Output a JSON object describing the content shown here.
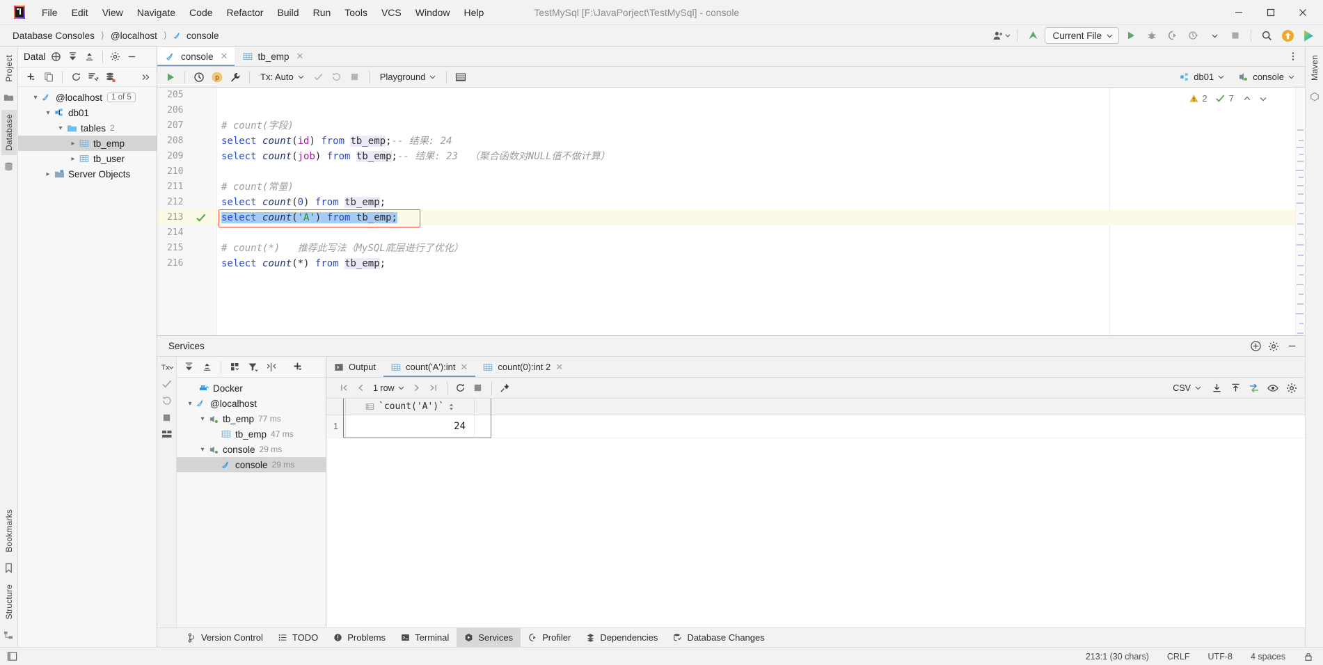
{
  "window": {
    "title": "TestMySql [F:\\JavaPorject\\TestMySql] - console",
    "minimize_label": "—",
    "maximize_label": "☐",
    "close_label": "✕"
  },
  "menubar": {
    "items": [
      {
        "label": "File"
      },
      {
        "label": "Edit"
      },
      {
        "label": "View"
      },
      {
        "label": "Navigate"
      },
      {
        "label": "Code"
      },
      {
        "label": "Refactor"
      },
      {
        "label": "Build"
      },
      {
        "label": "Run"
      },
      {
        "label": "Tools"
      },
      {
        "label": "VCS"
      },
      {
        "label": "Window"
      },
      {
        "label": "Help"
      }
    ]
  },
  "navbar": {
    "breadcrumbs": [
      "Database Consoles",
      "@localhost",
      "console"
    ],
    "run_config": "Current File",
    "icons": [
      "user-group-icon",
      "vcs-update-icon",
      "run-icon",
      "debug-icon",
      "coverage-icon",
      "profile-icon",
      "stop-icon",
      "search-icon",
      "update-available-icon",
      "ide-features-icon"
    ]
  },
  "left_stripe": {
    "tabs": [
      {
        "label": "Project",
        "active": false
      },
      {
        "label": "Database",
        "active": true
      }
    ],
    "bottom_tabs": [
      {
        "label": "Bookmarks"
      },
      {
        "label": "Structure"
      }
    ]
  },
  "right_stripe": {
    "tabs": [
      {
        "label": "Maven"
      }
    ]
  },
  "database_panel": {
    "title": "Datal",
    "header_icons": [
      "add-data-source-icon",
      "collapse-all-icon",
      "expand-all-icon",
      "settings-icon",
      "hide-icon"
    ],
    "toolbar_icons": [
      "new-icon",
      "copy-icon",
      "refresh-icon",
      "jump-to-query-icon",
      "db-tools-icon",
      "more-icon"
    ],
    "tree": [
      {
        "label": "@localhost",
        "icon": "mysql-icon",
        "depth": 0,
        "expanded": true,
        "badge": "1 of 5",
        "selected": false
      },
      {
        "label": "db01",
        "icon": "schema-icon",
        "depth": 1,
        "expanded": true,
        "selected": false
      },
      {
        "label": "tables",
        "icon": "folder-icon",
        "depth": 2,
        "expanded": true,
        "sub": "2",
        "selected": false
      },
      {
        "label": "tb_emp",
        "icon": "table-icon",
        "depth": 3,
        "expanded": false,
        "selected": true
      },
      {
        "label": "tb_user",
        "icon": "table-icon",
        "depth": 3,
        "expanded": false,
        "selected": false
      },
      {
        "label": "Server Objects",
        "icon": "server-objects-icon",
        "depth": 1,
        "expanded": false,
        "selected": false
      }
    ]
  },
  "editor": {
    "tabs": [
      {
        "label": "console",
        "icon": "mysql-icon",
        "active": true
      },
      {
        "label": "tb_emp",
        "icon": "table-icon",
        "active": false
      }
    ],
    "console_toolbar": {
      "execute_label": "run-icon",
      "history_label": "history-icon",
      "explain_label": "explain-plan-icon",
      "settings_label": "wrench-icon",
      "tx_label": "Tx: Auto",
      "commit_icon": "commit-icon",
      "rollback_icon": "rollback-icon",
      "stop_icon": "stop-icon",
      "playground_label": "Playground",
      "table_icon": "grid-icon",
      "schema_label": "db01",
      "session_label": "console"
    },
    "inspections": {
      "warnings": "2",
      "checks": "7"
    },
    "first_line_number": 205,
    "lines": [
      {
        "n": 205,
        "tokens": []
      },
      {
        "n": 206,
        "tokens": []
      },
      {
        "n": 207,
        "tokens": [
          {
            "t": "# count(字段)",
            "c": "cm"
          }
        ]
      },
      {
        "n": 208,
        "tokens": [
          {
            "t": "select ",
            "c": "kw"
          },
          {
            "t": "count",
            "c": "fn"
          },
          {
            "t": "(",
            "c": "pl"
          },
          {
            "t": "id",
            "c": "id"
          },
          {
            "t": ") ",
            "c": "pl"
          },
          {
            "t": "from ",
            "c": "kw"
          },
          {
            "t": "tb_emp",
            "c": "tbl"
          },
          {
            "t": ";",
            "c": "pl"
          },
          {
            "t": "-- ",
            "c": "cm"
          },
          {
            "t": "结果: 24",
            "c": "cm"
          }
        ]
      },
      {
        "n": 209,
        "tokens": [
          {
            "t": "select ",
            "c": "kw"
          },
          {
            "t": "count",
            "c": "fn"
          },
          {
            "t": "(",
            "c": "pl"
          },
          {
            "t": "job",
            "c": "id"
          },
          {
            "t": ") ",
            "c": "pl"
          },
          {
            "t": "from ",
            "c": "kw"
          },
          {
            "t": "tb_emp",
            "c": "tbl"
          },
          {
            "t": ";",
            "c": "pl"
          },
          {
            "t": "-- ",
            "c": "cm"
          },
          {
            "t": "结果: 23  （聚合函数对NULL值不做计算）",
            "c": "cm"
          }
        ]
      },
      {
        "n": 210,
        "tokens": []
      },
      {
        "n": 211,
        "tokens": [
          {
            "t": "# count(常量)",
            "c": "cm"
          }
        ]
      },
      {
        "n": 212,
        "tokens": [
          {
            "t": "select ",
            "c": "kw"
          },
          {
            "t": "count",
            "c": "fn"
          },
          {
            "t": "(",
            "c": "pl"
          },
          {
            "t": "0",
            "c": "num"
          },
          {
            "t": ") ",
            "c": "pl"
          },
          {
            "t": "from ",
            "c": "kw"
          },
          {
            "t": "tb_emp",
            "c": "tbl"
          },
          {
            "t": ";",
            "c": "pl"
          }
        ]
      },
      {
        "n": 213,
        "highlighted": true,
        "gutter_icon": "executed-ok-icon",
        "selected": true,
        "annotated": true,
        "tokens": [
          {
            "t": "select ",
            "c": "kw"
          },
          {
            "t": "count",
            "c": "fn"
          },
          {
            "t": "(",
            "c": "pl"
          },
          {
            "t": "'A'",
            "c": "str"
          },
          {
            "t": ") ",
            "c": "pl"
          },
          {
            "t": "from ",
            "c": "kw"
          },
          {
            "t": "tb_emp",
            "c": "pl"
          },
          {
            "t": ";",
            "c": "pl"
          }
        ]
      },
      {
        "n": 214,
        "tokens": []
      },
      {
        "n": 215,
        "tokens": [
          {
            "t": "# count(*)   推荐此写法（MySQL底层进行了优化）",
            "c": "cm"
          }
        ]
      },
      {
        "n": 216,
        "tokens": [
          {
            "t": "select ",
            "c": "kw"
          },
          {
            "t": "count",
            "c": "fn"
          },
          {
            "t": "(",
            "c": "pl"
          },
          {
            "t": "*",
            "c": "pl"
          },
          {
            "t": ") ",
            "c": "pl"
          },
          {
            "t": "from ",
            "c": "kw"
          },
          {
            "t": "tb_emp",
            "c": "tbl"
          },
          {
            "t": ";",
            "c": "pl"
          }
        ]
      }
    ]
  },
  "services": {
    "title": "Services",
    "header_icons": [
      "add-service-icon",
      "settings-icon",
      "hide-icon"
    ],
    "stripe_icons": [
      "tx-icon",
      "check-icon",
      "rerun-icon",
      "stop-icon",
      "layout-icon"
    ],
    "tree_toolbar_icons": [
      "collapse-icon",
      "expand-icon",
      "group-icon",
      "filter-icon",
      "layout-icon",
      "add-icon"
    ],
    "tree": [
      {
        "label": "Docker",
        "icon": "docker-icon",
        "depth": 1,
        "expanded": null,
        "selected": false
      },
      {
        "label": "@localhost",
        "icon": "mysql-icon",
        "depth": 0,
        "expanded": true,
        "selected": false
      },
      {
        "label": "tb_emp",
        "icon": "session-icon",
        "depth": 1,
        "expanded": true,
        "time": "77 ms",
        "selected": false
      },
      {
        "label": "tb_emp",
        "icon": "table-icon",
        "depth": 2,
        "expanded": null,
        "time": "47 ms",
        "selected": false
      },
      {
        "label": "console",
        "icon": "session-icon",
        "depth": 1,
        "expanded": true,
        "time": "29 ms",
        "selected": false
      },
      {
        "label": "console",
        "icon": "mysql-icon",
        "depth": 2,
        "expanded": null,
        "time": "29 ms",
        "selected": true
      }
    ],
    "tabs": [
      {
        "label": "Output",
        "icon": "output-icon",
        "active": false,
        "closable": false
      },
      {
        "label": "count('A'):int",
        "icon": "grid-icon",
        "active": true,
        "closable": true
      },
      {
        "label": "count(0):int 2",
        "icon": "grid-icon",
        "active": false,
        "closable": true
      }
    ],
    "grid_toolbar": {
      "first_icon": "first-page-icon",
      "prev_icon": "prev-page-icon",
      "rows_label": "1 row",
      "next_icon": "next-page-icon",
      "last_icon": "last-page-icon",
      "reload_icon": "reload-icon",
      "stop_icon": "stop-icon",
      "pin_icon": "pin-icon",
      "format_label": "CSV",
      "export_icon": "download-icon",
      "import_icon": "upload-icon",
      "compare_icon": "compare-icon",
      "view_icon": "eye-icon",
      "settings_icon": "settings-icon"
    },
    "result_grid": {
      "columns": [
        "`count('A')`"
      ],
      "rows": [
        {
          "num": "1",
          "values": [
            "24"
          ]
        }
      ]
    }
  },
  "tool_window_bar": {
    "items": [
      {
        "label": "Version Control",
        "icon": "branch-icon",
        "active": false
      },
      {
        "label": "TODO",
        "icon": "todo-icon",
        "active": false
      },
      {
        "label": "Problems",
        "icon": "problems-icon",
        "active": false
      },
      {
        "label": "Terminal",
        "icon": "terminal-icon",
        "active": false
      },
      {
        "label": "Services",
        "icon": "services-icon",
        "active": true
      },
      {
        "label": "Profiler",
        "icon": "profiler-icon",
        "active": false
      },
      {
        "label": "Dependencies",
        "icon": "dependencies-icon",
        "active": false
      },
      {
        "label": "Database Changes",
        "icon": "db-changes-icon",
        "active": false
      }
    ]
  },
  "statusbar": {
    "left_icon": "editor-layout-icon",
    "caret": "213:1 (30 chars)",
    "line_separator": "CRLF",
    "encoding": "UTF-8",
    "indent": "4 spaces",
    "lock_icon": "lock-icon"
  },
  "colors": {
    "accent_blue": "#7d99b8",
    "selection": "#a6cbf5",
    "annotation_red": "#f1563f",
    "keyword": "#2b4bc4",
    "string": "#1a8c1a",
    "identifier": "#9b1f9b",
    "comment": "#9d9d9d",
    "highlight_line": "#fcfae7",
    "success_green": "#5aa84f",
    "warning_yellow": "#e8b33a"
  }
}
